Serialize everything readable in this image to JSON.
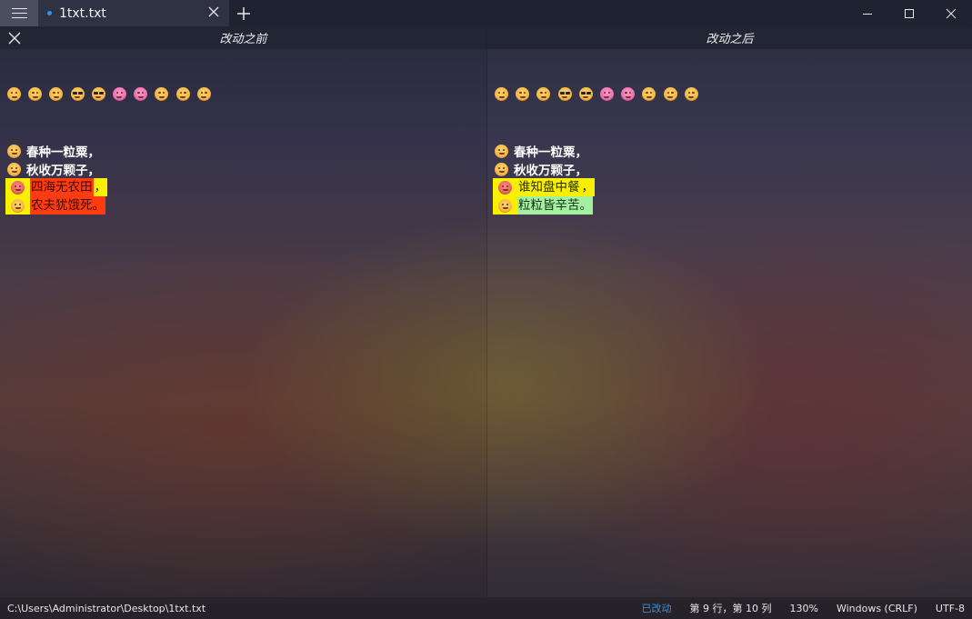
{
  "tab": {
    "title": "1txt.txt"
  },
  "diff": {
    "left_title": "改动之前",
    "right_title": "改动之后"
  },
  "emoji_strip": [
    "smile-icon",
    "smile-icon",
    "smile-icon",
    "glasses-icon",
    "glasses-icon",
    "heart-eyes-icon",
    "heart-eyes-icon",
    "smile-icon",
    "smile-icon",
    "sad-icon"
  ],
  "left_lines": [
    {
      "text": "春种一粒粟，",
      "icon": "grin-icon"
    },
    {
      "text": "秋收万颗子，",
      "icon": "smile-icon"
    },
    {
      "text": "四海无农田",
      "punct": "，",
      "icon": "red-face-icon"
    },
    {
      "text": "农夫犹饿死。",
      "icon": "surprised-icon"
    }
  ],
  "right_lines": [
    {
      "text": "春种一粒粟，",
      "icon": "grin-icon"
    },
    {
      "text": "秋收万颗子，",
      "icon": "smile-icon"
    },
    {
      "text": "谁知盘中餐",
      "punct": "，",
      "icon": "red-face-icon"
    },
    {
      "text": "粒粒皆辛苦。",
      "icon": "surprised-icon"
    }
  ],
  "status": {
    "path": "C:\\Users\\Administrator\\Desktop\\1txt.txt",
    "modified": "已改动",
    "position": "第 9 行，第 10 列",
    "zoom": "130%",
    "line_ending": "Windows (CRLF)",
    "encoding": "UTF-8"
  },
  "colors": {
    "deleted_bg": "#ff3b12",
    "added_bg": "#a4f0a0",
    "changed_marker": "#f8f000",
    "accent": "#3b8fe0"
  }
}
